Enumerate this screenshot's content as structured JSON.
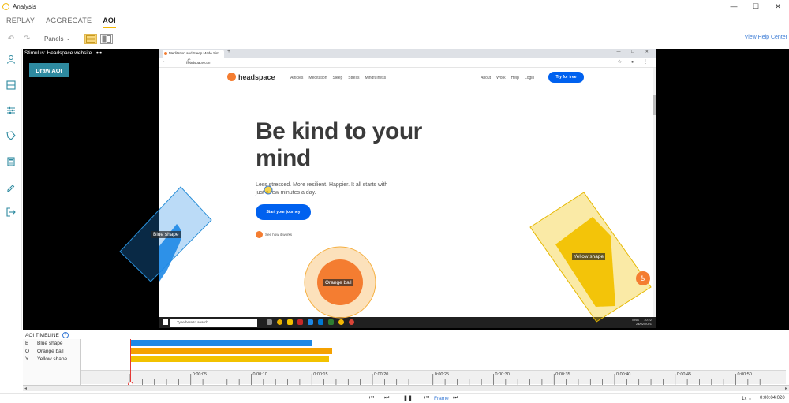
{
  "window": {
    "title": "Analysis",
    "controls": [
      "—",
      "☐",
      "✕"
    ]
  },
  "tabs": [
    {
      "label": "REPLAY",
      "active": false
    },
    {
      "label": "AGGREGATE",
      "active": false
    },
    {
      "label": "AOI",
      "active": true
    }
  ],
  "toolbar": {
    "undo_icon": "undo-icon",
    "redo_icon": "redo-icon",
    "panels_label": "Panels",
    "help_link": "View Help Center"
  },
  "sidebar": {
    "items": [
      {
        "icon": "person-icon"
      },
      {
        "icon": "film-icon"
      },
      {
        "icon": "sliders-icon"
      },
      {
        "icon": "tag-icon"
      },
      {
        "icon": "calculator-icon"
      },
      {
        "icon": "pencil-icon"
      },
      {
        "icon": "exit-icon"
      }
    ]
  },
  "stage": {
    "stimulus_label": "Stimulus: Headspace website",
    "menu_dots": "•••",
    "draw_button": "Draw AOI"
  },
  "browser": {
    "tab_title": "Meditation and Sleep Made Sim...",
    "tab_close": "×",
    "new_tab": "+",
    "window_controls": "— ☐ ✕",
    "nav": "← → C",
    "url": "headspace.com",
    "right_icons": "☆ ● ⋮"
  },
  "site": {
    "logo_text": "headspace",
    "nav_left": [
      "Articles",
      "Meditation",
      "Sleep",
      "Stress",
      "Mindfulness"
    ],
    "nav_right": [
      "About",
      "Work",
      "Help",
      "Login"
    ],
    "try_button": "Try for free",
    "headline": "Be kind to your mind",
    "subtext": "Less stressed. More resilient. Happier. It all starts with just a few minutes a day.",
    "cta_button": "Start your journey",
    "how_link": "See how it works"
  },
  "taskbar": {
    "search_placeholder": "Type here to search",
    "clock_time": "10:22",
    "clock_date": "24/02/2021",
    "lang": "ENG"
  },
  "aois": [
    {
      "key": "B",
      "name": "Blue shape",
      "label": "Blue shape",
      "color": "#1e88e5",
      "start": 0.0,
      "end": 15.0
    },
    {
      "key": "O",
      "name": "Orange ball",
      "label": "Orange ball",
      "color": "#f5a100",
      "start": 0.0,
      "end": 16.7
    },
    {
      "key": "Y",
      "name": "Yellow shape",
      "label": "Yellow shape",
      "color": "#f2c200",
      "start": 0.0,
      "end": 16.4
    }
  ],
  "timeline": {
    "title": "AOI TIMELINE",
    "info_icon": "?",
    "ticks": [
      "0:00:05",
      "0:00:10",
      "0:00:15",
      "0:00:20",
      "0:00:25",
      "0:00:30",
      "0:00:35",
      "0:00:40",
      "0:00:45",
      "0:00:50",
      "0:00:55"
    ]
  },
  "playback": {
    "skip_back": "⏮",
    "step_fwd": "⏭",
    "pause": "❚❚",
    "frame_back": "⏮",
    "frame_label": "Frame",
    "frame_fwd": "⏭",
    "speed": "1x ⌄",
    "time": "0:00:04:020"
  },
  "colors": {
    "accent": "#f2b705",
    "teal_button": "#2e8aa0",
    "headspace_orange": "#f47d31",
    "headspace_blue": "#0061ef",
    "link_blue": "#3a7bd5",
    "playhead": "#e53935"
  }
}
